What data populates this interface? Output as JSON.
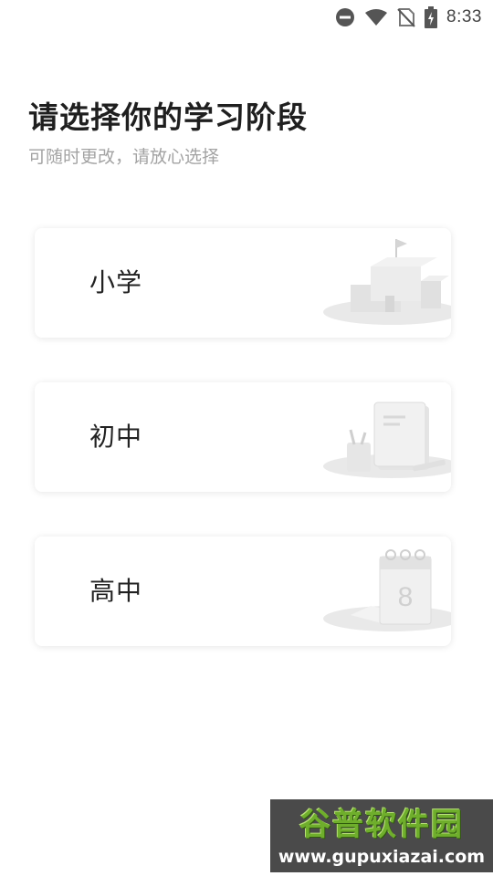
{
  "status_bar": {
    "time": "8:33",
    "icons": [
      "dnd-icon",
      "wifi-icon",
      "no-sim-icon",
      "battery-charging-icon"
    ]
  },
  "header": {
    "title": "请选择你的学习阶段",
    "subtitle": "可随时更改，请放心选择"
  },
  "options": [
    {
      "label": "小学",
      "illustration": "school-building-icon"
    },
    {
      "label": "初中",
      "illustration": "books-and-pencil-cup-icon"
    },
    {
      "label": "高中",
      "illustration": "calendar-icon"
    }
  ],
  "watermark": {
    "title": "谷普软件园",
    "url": "www.gupuxiazai.com"
  },
  "colors": {
    "title": "#1f1f1f",
    "subtitle": "#a3a3a3",
    "card_shadow": "rgba(0,0,0,0.10)",
    "illustration_gray": "#e6e6e6",
    "watermark_green": "#6fae2c"
  }
}
